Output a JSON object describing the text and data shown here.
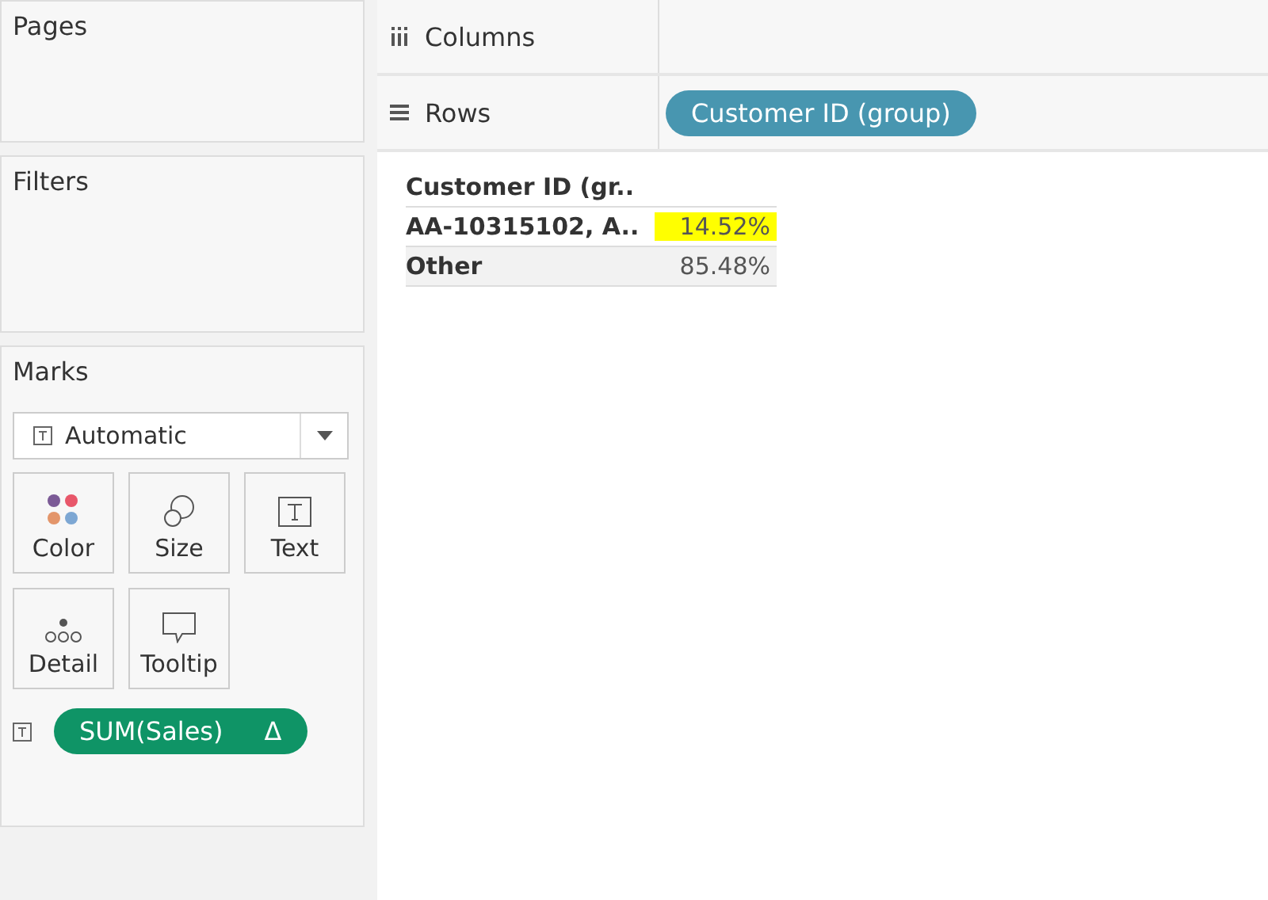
{
  "cards": {
    "pages": "Pages",
    "filters": "Filters"
  },
  "shelves": [
    {
      "kind": "columns",
      "label": "Columns"
    },
    {
      "kind": "rows",
      "label": "Rows",
      "pills": [
        "Customer ID (group)"
      ]
    }
  ],
  "marks": {
    "title": "Marks",
    "mark_type": "Automatic",
    "buttons": [
      {
        "kind": "color",
        "label": "Color"
      },
      {
        "kind": "size",
        "label": "Size"
      },
      {
        "kind": "text",
        "label": "Text"
      },
      {
        "kind": "detail",
        "label": "Detail"
      },
      {
        "kind": "tooltip",
        "label": "Tooltip"
      }
    ],
    "fields": [
      {
        "label": "SUM(Sales)",
        "delta": "Δ"
      }
    ]
  },
  "table": {
    "header": "Customer ID (gr..",
    "rows": [
      {
        "label": "AA-10315102, A..",
        "value": "14.52%",
        "highlighted": true
      },
      {
        "label": "Other",
        "value": "85.48%",
        "highlighted": false
      }
    ]
  }
}
